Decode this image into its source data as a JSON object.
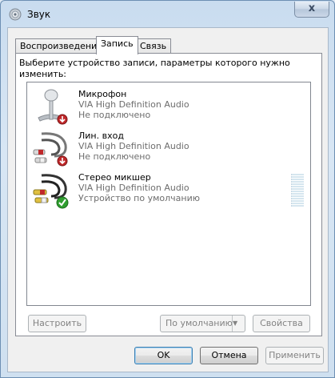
{
  "window": {
    "title": "Звук",
    "close_glyph": "x"
  },
  "tabs": [
    {
      "label": "Воспроизведение",
      "active": false
    },
    {
      "label": "Запись",
      "active": true
    },
    {
      "label": "Связь",
      "active": false
    }
  ],
  "instructions": "Выберите устройство записи, параметры которого нужно изменить:",
  "devices": [
    {
      "name": "Микрофон",
      "driver": "VIA High Definition Audio",
      "status": "Не подключено",
      "icon": "microphone-icon",
      "badge": "red-down-arrow-badge"
    },
    {
      "name": "Лин. вход",
      "driver": "VIA High Definition Audio",
      "status": "Не подключено",
      "icon": "rca-cable-icon",
      "badge": "red-down-arrow-badge"
    },
    {
      "name": "Стерео микшер",
      "driver": "VIA High Definition Audio",
      "status": "Устройство по умолчанию",
      "icon": "rca-cable-icon",
      "badge": "green-check-badge",
      "level": 0
    }
  ],
  "panel_buttons": {
    "configure": "Настроить",
    "set_default": "По умолчанию",
    "properties": "Свойства"
  },
  "dialog_buttons": {
    "ok": "OK",
    "cancel": "Отмена",
    "apply": "Применить"
  },
  "colors": {
    "status_text": "#6d6d6d",
    "badge_red": "#c0282a",
    "badge_green": "#2f9e2f"
  }
}
